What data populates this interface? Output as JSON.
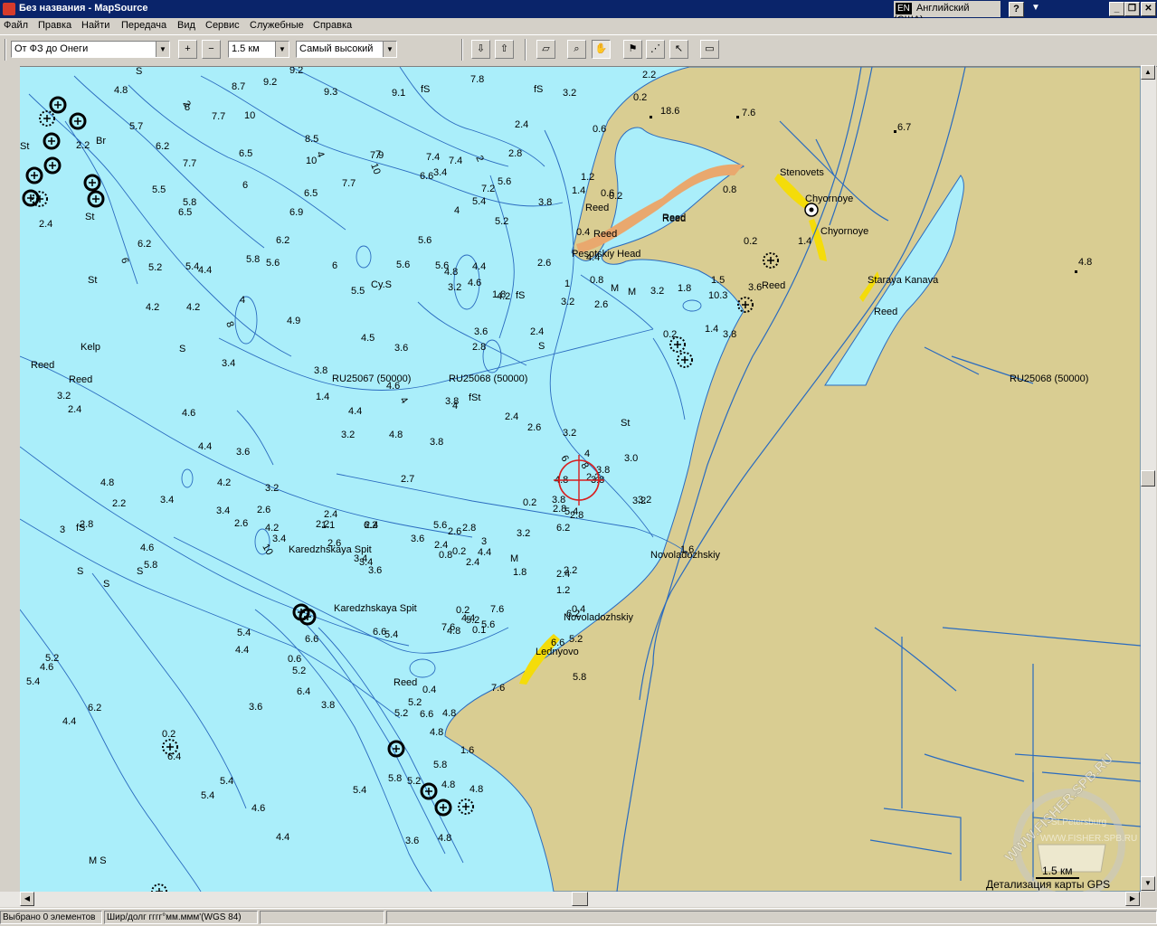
{
  "window": {
    "title": "Без названия - MapSource",
    "language_badge": "EN",
    "language_name": "Английский (США)",
    "help_glyph": "?",
    "title_arrow": "▼",
    "min_glyph": "_",
    "max_glyph": "❐",
    "close_glyph": "✕"
  },
  "menu": [
    "Файл",
    "Правка",
    "Найти",
    "Передача",
    "Вид",
    "Сервис",
    "Служебные",
    "Справка"
  ],
  "toolbar": {
    "route_select": "От ФЗ до Онеги",
    "zoom_select": "1.5 км",
    "detail_select": "Самый высокий",
    "buttons": [
      {
        "name": "zoom-in-icon",
        "glyph": "+"
      },
      {
        "name": "zoom-out-icon",
        "glyph": "−"
      },
      {
        "name": "receive-from-device-icon",
        "glyph": "⇩"
      },
      {
        "name": "send-to-device-icon",
        "glyph": "⇧"
      },
      {
        "name": "map-tool-icon",
        "glyph": "▱"
      },
      {
        "name": "zoom-tool-icon",
        "glyph": "⌕"
      },
      {
        "name": "hand-tool-icon",
        "glyph": "✋"
      },
      {
        "name": "waypoint-tool-icon",
        "glyph": "⚑"
      },
      {
        "name": "route-tool-icon",
        "glyph": "⋰"
      },
      {
        "name": "select-tool-icon",
        "glyph": "↖"
      },
      {
        "name": "distance-tool-icon",
        "glyph": "▭"
      }
    ],
    "combo_arrow": "▼"
  },
  "map": {
    "colors": {
      "water": "#aaeefa",
      "land": "#d9cd92",
      "shore_sand": "#e9a86e",
      "highlight": "#f4dc0a",
      "contour": "#2a6bbf",
      "cursor": "#d81e1e"
    },
    "place_labels": [
      "RU25067 (50000)",
      "RU25068 (50000)",
      "RU25068 (50000)",
      "Pesotskiy Head",
      "Stenovets",
      "Chyornoye",
      "Chyornoye",
      "Staraya Kanava",
      "Karedzhskaya Spit",
      "Karedzhskaya Spit",
      "Novoladozhskiy",
      "Novoladozhskiy",
      "Lednyovo",
      "Kelp"
    ],
    "seabed_labels": [
      "Reed",
      "Reed",
      "Reed",
      "Reed",
      "Reed",
      "Reed",
      "Reed",
      "Reed",
      "Reed",
      "S",
      "S",
      "S",
      "S",
      "S",
      "S",
      "fS",
      "fS",
      "fS",
      "fS",
      "St",
      "St",
      "St",
      "St",
      "Br",
      "Cy.S",
      "M",
      "M",
      "M",
      "M S",
      "fSt"
    ],
    "soundings": [
      "4.8",
      "8.7",
      "9.2",
      "7.8",
      "3.2",
      "0.2",
      "2.2",
      "18.6",
      "7.6",
      "6.7",
      "8",
      "9.2",
      "9.3",
      "9.1",
      "5.7",
      "7.7",
      "10",
      "8.5",
      "10",
      "7.4",
      "2.4",
      "0.6",
      "6.2",
      "7.7",
      "6.5",
      "7.9",
      "7.4",
      "3.4",
      "2.8",
      "0.4",
      "0.6",
      "5.8",
      "6",
      "6.5",
      "7",
      "6.6",
      "7.2",
      "5.5",
      "2.2",
      "2.4",
      "5.6",
      "3.8",
      "1.4",
      "0.2",
      "5.4",
      "5.8",
      "6.9",
      "7.7",
      "4",
      "5.4",
      "5.2",
      "6",
      "5.6",
      "3.2",
      "1",
      "1.2",
      "0.8",
      "0.2",
      "1.4",
      "4.4",
      "6.2",
      "6.5",
      "6.2",
      "5.6",
      "5.6",
      "4.8",
      "4.4",
      "2.6",
      "1.8",
      "10.3",
      "4.8",
      "5.2",
      "4.4",
      "4",
      "5.6",
      "5.5",
      "4.6",
      "4.2",
      "3.2",
      "0.8",
      "1.5",
      "3.6",
      "4.2",
      "4.2",
      "4.9",
      "4.5",
      "3.6",
      "3.6",
      "2.8",
      "2.4",
      "1.8",
      "1.4",
      "0.2",
      "3.8",
      "3.2",
      "2.6",
      "3.4",
      "1.4",
      "3.8",
      "4.6",
      "4.4",
      "3.8",
      "4.8",
      "3.8",
      "4",
      "2.4",
      "2.6",
      "3.2",
      "3.2",
      "2.4",
      "4.6",
      "4.4",
      "3.6",
      "4.2",
      "3.4",
      "3.2",
      "2.6",
      "4.2",
      "2.2",
      "1.1",
      "2.4",
      "3.2",
      "2.7",
      "4.8",
      "3.8",
      "4",
      "3.8",
      "3.8",
      "3.0",
      "3.2",
      "3.2",
      "2.4",
      "3.4",
      "3.6",
      "3.4",
      "3.6",
      "2.6",
      "3",
      "0.2",
      "6.2",
      "5.4",
      "2.2",
      "1.6",
      "3",
      "2.8",
      "3.4",
      "2.6",
      "3.4",
      "2.6",
      "6.2",
      "5.6",
      "4.4",
      "3.2",
      "2.8",
      "2.8",
      "2.2",
      "4.8",
      "4.6",
      "2.4",
      "2.4",
      "2.8",
      "2.4",
      "2.2",
      "0.8",
      "0.2",
      "1.8",
      "1.2",
      "0.4",
      "6.6",
      "5.8",
      "5.2",
      "5.6",
      "5.2",
      "4.8",
      "4.4",
      "0.1",
      "0.2",
      "7.6",
      "7.6",
      "6.2",
      "5.8",
      "5.4",
      "5.2",
      "3.6",
      "3.8",
      "0.4",
      "6.6",
      "6.6",
      "5.4",
      "5.4",
      "5.2",
      "4.6",
      "4.4",
      "0.6",
      "6.6",
      "6.4",
      "5.2",
      "5.2",
      "4.8",
      "4.8",
      "4.4",
      "0.2",
      "5.4",
      "5.4",
      "5.8",
      "5.2",
      "4.8",
      "1.6",
      "7.6",
      "6.2",
      "6.4",
      "5.4",
      "4.6",
      "4.4",
      "3.6",
      "4.8",
      "5.8",
      "4.8"
    ],
    "depth_contour_labels": [
      "2",
      "4",
      "6",
      "8",
      "10"
    ],
    "scale_value": "1.5 км",
    "scale_caption": "Детализация карты GPS",
    "watermark": "WWW.FISHER.SPB.RU",
    "watermark_sub": "St.Petersburg",
    "watermark_small": "WWW.FISHER.SPB.RU"
  },
  "scroll": {
    "up": "▲",
    "down": "▼",
    "left": "◀",
    "right": "▶"
  },
  "status": {
    "selected": "Выбрано 0 элементов",
    "coord_format": "Шир/долг гггг°мм.ммм'(WGS 84)"
  }
}
